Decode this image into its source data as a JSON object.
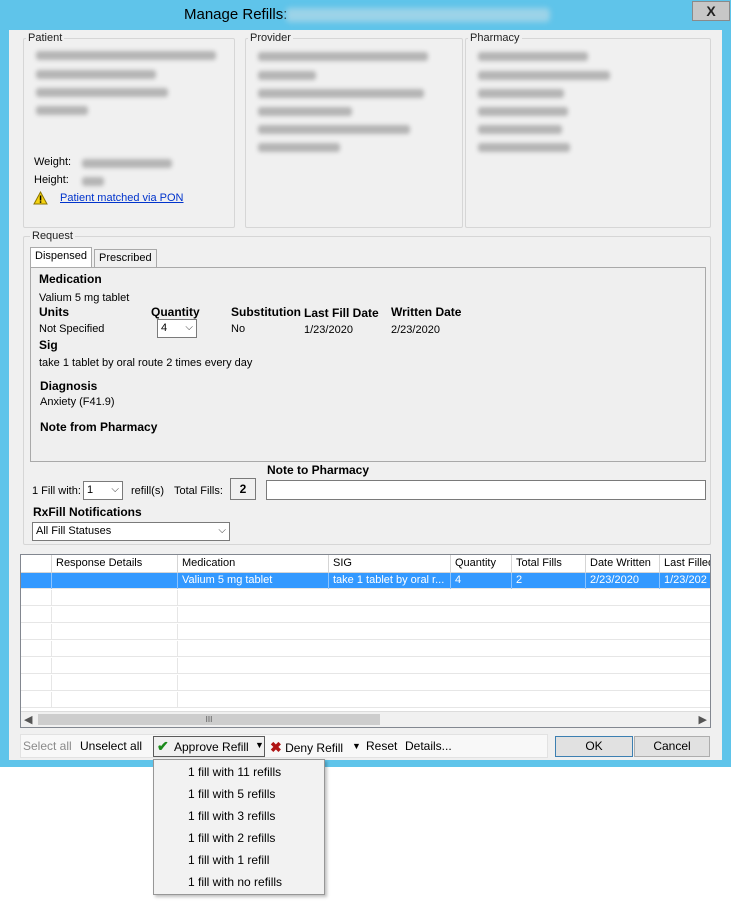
{
  "window": {
    "title": "Manage Refills:",
    "close_glyph": "X"
  },
  "patient": {
    "label": "Patient",
    "weight_label": "Weight:",
    "height_label": "Height:",
    "match_link": "Patient matched via PON"
  },
  "provider": {
    "label": "Provider"
  },
  "pharmacy": {
    "label": "Pharmacy"
  },
  "request": {
    "label": "Request",
    "tabs": [
      "Dispensed",
      "Prescribed"
    ],
    "medication_heading": "Medication",
    "medication": "Valium 5 mg tablet",
    "units_heading": "Units",
    "units": "Not Specified",
    "quantity_heading": "Quantity",
    "quantity": "4",
    "substitution_heading": "Substitution",
    "substitution": "No",
    "last_fill_heading": "Last Fill Date",
    "last_fill": "1/23/2020",
    "written_heading": "Written Date",
    "written": "2/23/2020",
    "sig_heading": "Sig",
    "sig": "take 1 tablet by oral route 2 times every day",
    "diagnosis_heading": "Diagnosis",
    "diagnosis": "Anxiety (F41.9)",
    "note_heading": "Note from Pharmacy"
  },
  "fill": {
    "fill_with_label": "1 Fill with:",
    "refills_value": "1",
    "refills_label": "refill(s)",
    "total_fills_label": "Total Fills:",
    "total_fills": "2",
    "note_to_pharmacy_label": "Note to Pharmacy",
    "note_to_pharmacy": ""
  },
  "rxfill": {
    "label": "RxFill Notifications",
    "selected": "All Fill Statuses"
  },
  "grid": {
    "columns": [
      "",
      "Response Details",
      "Medication",
      "SIG",
      "Quantity",
      "Total Fills",
      "Date Written",
      "Last Filled"
    ],
    "rows": [
      [
        "",
        "",
        "Valium 5 mg tablet",
        "take 1 tablet by oral r...",
        "4",
        "2",
        "2/23/2020",
        "1/23/202"
      ]
    ],
    "scroll_grip": "III"
  },
  "toolbar": {
    "select_all": "Select all",
    "unselect_all": "Unselect all",
    "approve": "Approve Refill",
    "deny": "Deny Refill",
    "reset": "Reset",
    "details": "Details..."
  },
  "buttons": {
    "ok": "OK",
    "cancel": "Cancel"
  },
  "approve_menu": [
    "1 fill with 11 refills",
    "1 fill with 5 refills",
    "1 fill with 3 refills",
    "1 fill with 2 refills",
    "1 fill with 1 refill",
    "1 fill with no refills"
  ],
  "colors": {
    "title_bar": "#5fc4ea",
    "selection": "#3399ff",
    "link": "#0033cc",
    "approve_check": "#1b8a1b",
    "deny_x": "#b01515"
  }
}
